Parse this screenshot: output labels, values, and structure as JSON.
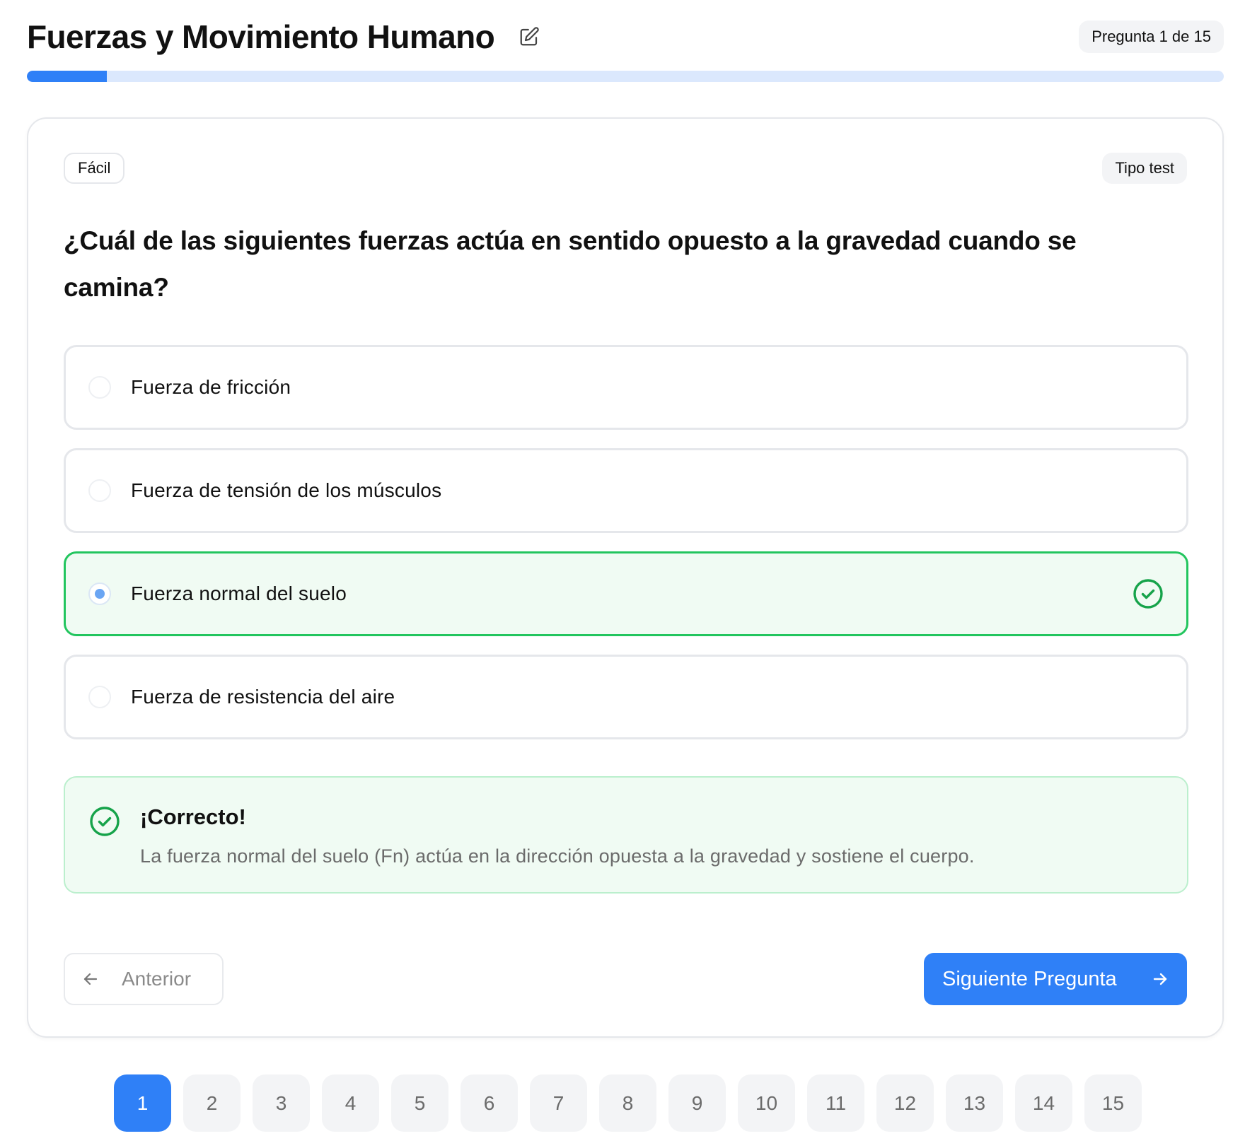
{
  "header": {
    "title": "Fuerzas y Movimiento Humano",
    "counter": "Pregunta 1 de 15"
  },
  "progress": {
    "fraction": 0.0667
  },
  "question": {
    "difficulty": "Fácil",
    "type": "Tipo test",
    "text": "¿Cuál de las siguientes fuerzas actúa en sentido opuesto a la gravedad cuando se camina?",
    "options": [
      {
        "label": "Fuerza de fricción",
        "selected": false,
        "correct": false
      },
      {
        "label": "Fuerza de tensión de los músculos",
        "selected": false,
        "correct": false
      },
      {
        "label": "Fuerza normal del suelo",
        "selected": true,
        "correct": true
      },
      {
        "label": "Fuerza de resistencia del aire",
        "selected": false,
        "correct": false
      }
    ]
  },
  "feedback": {
    "title": "¡Correcto!",
    "text": "La fuerza normal del suelo (Fn) actúa en la dirección opuesta a la gravedad y sostiene el cuerpo."
  },
  "navigation": {
    "prev_label": "Anterior",
    "next_label": "Siguiente Pregunta"
  },
  "pager": {
    "current": 1,
    "pages": [
      "1",
      "2",
      "3",
      "4",
      "5",
      "6",
      "7",
      "8",
      "9",
      "10",
      "11",
      "12",
      "13",
      "14",
      "15"
    ]
  },
  "colors": {
    "accent": "#2f80f7",
    "success": "#22c55e",
    "success_bg": "#f0fbf3",
    "progress_track": "#dbe8fd"
  },
  "icons": {
    "edit": "edit-icon",
    "check": "check-circle-icon",
    "prev": "arrow-left-icon",
    "next": "arrow-right-icon"
  }
}
